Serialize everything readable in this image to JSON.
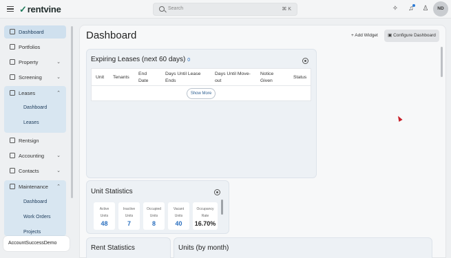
{
  "topbar": {
    "brand": "rentvine",
    "search_placeholder": "Search",
    "search_shortcut": "⌘ K",
    "avatar_initials": "ND"
  },
  "sidebar": {
    "items": [
      {
        "label": "Dashboard",
        "active": true
      },
      {
        "label": "Portfolios"
      },
      {
        "label": "Property"
      },
      {
        "label": "Screening"
      },
      {
        "label": "Leases"
      },
      {
        "label": "Rentsign"
      },
      {
        "label": "Accounting"
      },
      {
        "label": "Contacts"
      },
      {
        "label": "Maintenance"
      }
    ],
    "leases_sub": [
      "Dashboard",
      "Leases"
    ],
    "maintenance_sub": [
      "Dashboard",
      "Work Orders",
      "Projects"
    ],
    "account_name": "AccountSuccessDemo"
  },
  "main": {
    "title": "Dashboard",
    "add_widget": "Add Widget",
    "configure": "Configure Dashboard"
  },
  "expiring": {
    "title": "Expiring Leases (next 60 days)",
    "count": "0",
    "columns": [
      "Unit",
      "Tenants",
      "End Date",
      "Days Until Lease Ends",
      "Days Until Move-out",
      "Notice Given",
      "Status"
    ],
    "show_more": "Show More"
  },
  "unit_stats": {
    "title": "Unit Statistics",
    "cards": [
      {
        "label1": "Active",
        "label2": "Units",
        "value": "48"
      },
      {
        "label1": "Inactive",
        "label2": "Units",
        "value": "7"
      },
      {
        "label1": "Occupied",
        "label2": "Units",
        "value": "8"
      },
      {
        "label1": "Vacant",
        "label2": "Units",
        "value": "40"
      },
      {
        "label1": "Occupancy",
        "label2": "Rate",
        "value": "16.70%"
      }
    ]
  },
  "partial_widgets": {
    "rent_title": "Rent Statistics",
    "units_title": "Units (by month)"
  },
  "colors": {
    "accent": "#2a6fbf",
    "active_nav": "#cfe0ee",
    "brand": "#1e7a5a"
  }
}
